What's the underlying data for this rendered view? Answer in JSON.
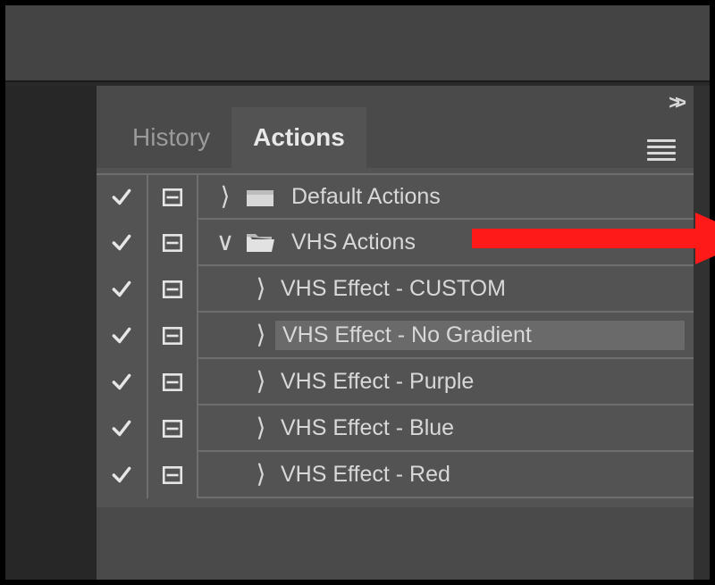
{
  "tabs": {
    "history": "History",
    "actions": "Actions",
    "active": "actions"
  },
  "rows": [
    {
      "label": "Default Actions",
      "kind": "set",
      "expanded": false,
      "folderOpen": false,
      "selected": false
    },
    {
      "label": "VHS Actions",
      "kind": "set",
      "expanded": true,
      "folderOpen": true,
      "selected": false
    },
    {
      "label": "VHS Effect - CUSTOM",
      "kind": "action",
      "selected": false
    },
    {
      "label": "VHS Effect - No Gradient",
      "kind": "action",
      "selected": true
    },
    {
      "label": "VHS Effect - Purple",
      "kind": "action",
      "selected": false
    },
    {
      "label": "VHS Effect - Blue",
      "kind": "action",
      "selected": false
    },
    {
      "label": "VHS Effect - Red",
      "kind": "action",
      "selected": false
    }
  ],
  "icons": {
    "collapse": ">>"
  },
  "annotation": {
    "color": "#ff1a1a"
  }
}
